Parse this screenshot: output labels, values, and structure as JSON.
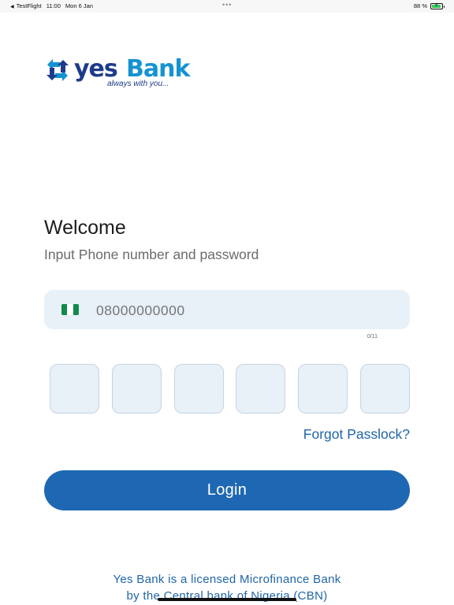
{
  "status_bar": {
    "back_app": "TestFlight",
    "time": "11:00",
    "date": "Mon 6 Jan",
    "battery": "88 %",
    "battery_level": 0.88
  },
  "logo": {
    "word_yes": "yes",
    "word_bank": "Bank",
    "tagline": "always with you..."
  },
  "welcome": {
    "title": "Welcome",
    "subtitle": "Input Phone number and password"
  },
  "phone": {
    "placeholder": "08000000000",
    "value": "",
    "counter": "0/11",
    "flag_colors": [
      "#118a4b",
      "#ffffff",
      "#118a4b"
    ]
  },
  "pin": {
    "digits": 6
  },
  "actions": {
    "forgot_label": "Forgot Passlock?",
    "login_label": "Login"
  },
  "footer": {
    "line1": "Yes Bank is a licensed Microfinance Bank",
    "line2": "by the Central bank of Nigeria (CBN)"
  },
  "colors": {
    "primary": "#1e68b3",
    "field_bg": "#e8f0f8",
    "link": "#2166a8",
    "brand_dark": "#1d3b8b",
    "brand_light": "#1593d1"
  }
}
